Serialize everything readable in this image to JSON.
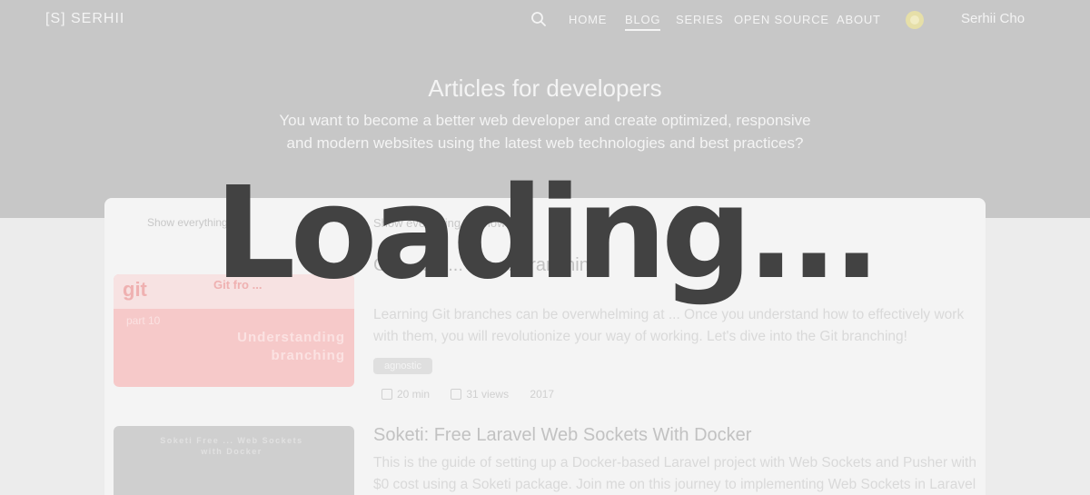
{
  "nav": {
    "brand": "[S] SERHII",
    "links": [
      "HOME",
      "BLOG",
      "SERIES",
      "OPEN SOURCE",
      "ABOUT"
    ],
    "active_link": "BLOG",
    "user": "Serhii Cho",
    "search_icon": "search-icon",
    "theme_icon": "sun-icon",
    "link_color": "#f4f4f4"
  },
  "hero": {
    "title": "Articles for developers",
    "subtitle": "You want to become a better web developer and create optimized, responsive and modern websites using the latest web technologies and best practices?"
  },
  "filters": {
    "select_label": "Show everything",
    "pills": [
      "Show everything",
      "Show ..."
    ]
  },
  "posts": [
    {
      "title": "Git ... ter ... ce: ... Branching",
      "description": "Learning Git branches can be overwhelming at ... Once you understand how to effectively work with them, you will revolutionize your way of working. Let's dive into the Git branching!",
      "tag": "agnostic",
      "read_time": "20 min",
      "views": "31 views",
      "extra": "2017",
      "thumb_logo": "git",
      "thumb_title": "Git fro ...",
      "thumb_caption": "Understanding branching",
      "thumb_tag": "part 10"
    },
    {
      "title": "Soketi: Free Laravel Web Sockets With Docker",
      "description": "This is the guide of setting up a Docker-based Laravel project with Web Sockets and Pusher with $0 cost using a Soketi package. Join me on this journey to implementing Web Sockets in Laravel",
      "thumb_caption": "Soketi Free ... Web Sockets with Docker"
    }
  ],
  "overlay": {
    "text": "Loading..."
  },
  "colors": {
    "hero_bg": "#c7c7c7",
    "page_bg": "#ececec",
    "overlay_text": "#424242",
    "thumb_red": "#f6c9c9"
  }
}
